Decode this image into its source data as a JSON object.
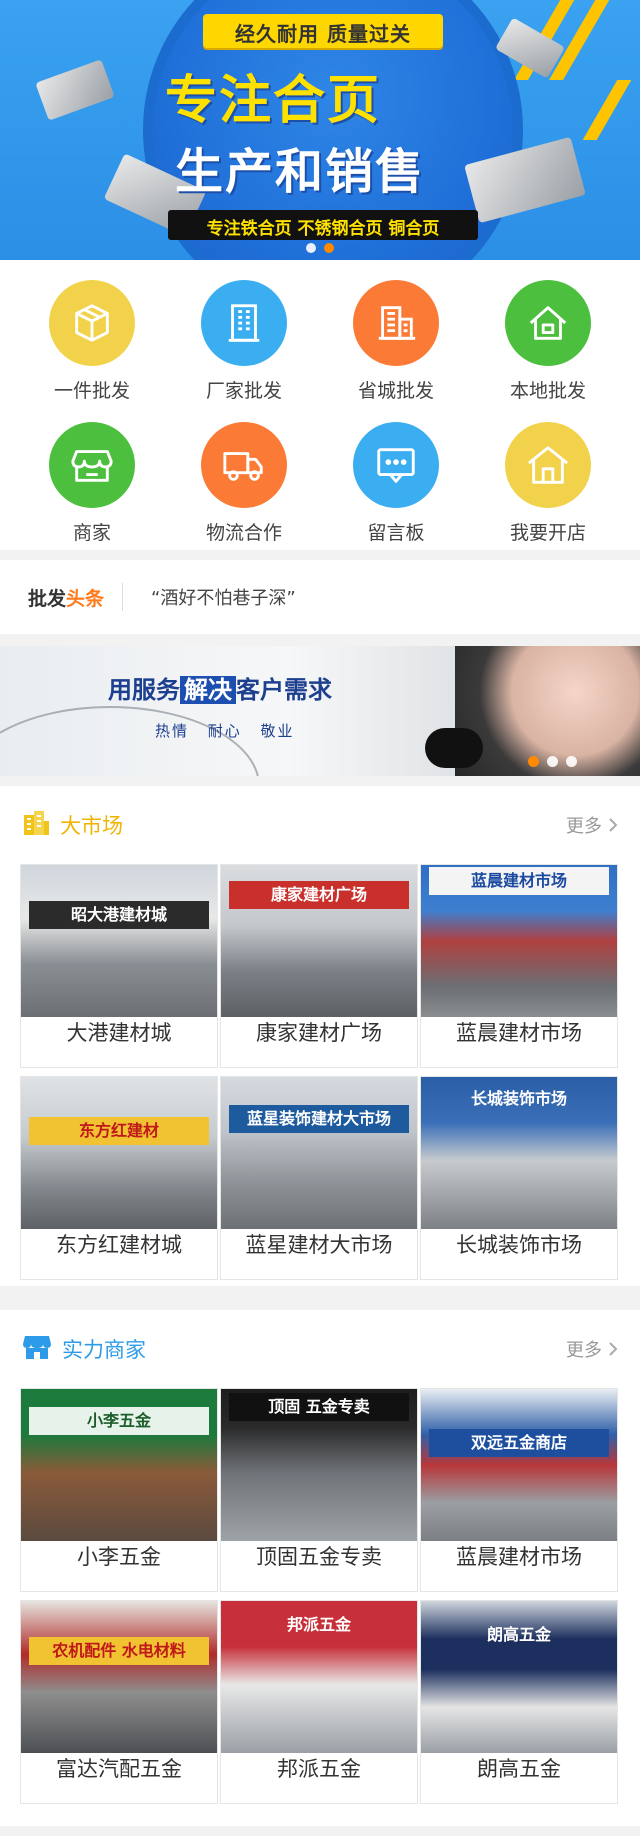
{
  "hero": {
    "ribbon": "经久耐用 质量过关",
    "headline1": "专注合页",
    "headline2": "生产和销售",
    "tagline": "专注铁合页 不锈钢合页 铜合页"
  },
  "icons": [
    {
      "label": "一件批发",
      "icon": "box-icon",
      "color": "#f2d24b"
    },
    {
      "label": "厂家批发",
      "icon": "building-icon",
      "color": "#3aaef0"
    },
    {
      "label": "省城批发",
      "icon": "office-building-icon",
      "color": "#fb7a35"
    },
    {
      "label": "本地批发",
      "icon": "house-icon",
      "color": "#4cbf3e"
    },
    {
      "label": "商家",
      "icon": "storefront-icon",
      "color": "#4cbf3e"
    },
    {
      "label": "物流合作",
      "icon": "truck-icon",
      "color": "#fb7a35"
    },
    {
      "label": "留言板",
      "icon": "message-icon",
      "color": "#3aaef0"
    },
    {
      "label": "我要开店",
      "icon": "shop-house-icon",
      "color": "#f2d24b"
    }
  ],
  "news": {
    "brand_a": "批发",
    "brand_b": "头条",
    "text": "“酒好不怕巷子深”"
  },
  "ad": {
    "title_a": "用服务",
    "title_hl": "解决",
    "title_b": "客户需求",
    "sub": "热情 耐心 敬业"
  },
  "market": {
    "title": "大市场",
    "more": "更多",
    "items": [
      "大港建材城",
      "康家建材广场",
      "蓝晨建材市场",
      "东方红建材城",
      "蓝星建材大市场",
      "长城装饰市场"
    ],
    "signs": [
      "昭大港建材城",
      "康家建材广场",
      "蓝晨建材市场",
      "东方红建材",
      "蓝星装饰建材大市场",
      "长城装饰市场"
    ]
  },
  "merchants": {
    "title": "实力商家",
    "more": "更多",
    "items": [
      "小李五金",
      "顶固五金专卖",
      "蓝晨建材市场",
      "富达汽配五金",
      "邦派五金",
      "朗高五金"
    ],
    "signs": [
      "小李五金",
      "顶固 五金专卖",
      "双远五金商店",
      "农机配件 水电材料",
      "邦派五金",
      "朗高五金"
    ]
  },
  "colors": {
    "accent": "#ff7a1a",
    "market_title": "#f0b400",
    "merchant_title": "#2e9be8"
  }
}
